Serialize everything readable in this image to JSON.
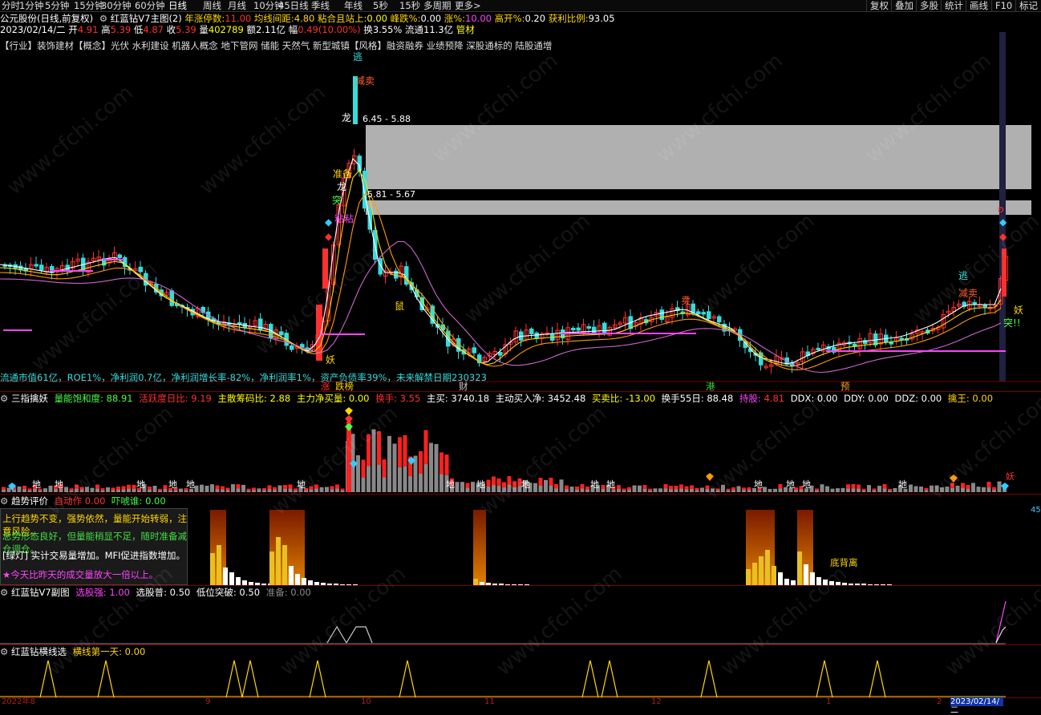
{
  "toolbar": {
    "left_items": [
      "分时",
      "1分钟",
      "5分钟",
      "15分钟",
      "30分钟",
      "60分钟",
      "日线",
      "周线",
      "月线",
      "10分钟",
      "45日线",
      "季线",
      "年线",
      "5秒",
      "15秒",
      "多周期",
      "更多>"
    ],
    "active_index": 6,
    "right_items": [
      "复权",
      "叠加",
      "多股",
      "统计",
      "画线",
      "F10",
      "标记"
    ]
  },
  "header": {
    "title": "公元股份(日线,前复权)",
    "indicator": "红蓝钻V7主图(2)",
    "fields": [
      {
        "label": "年涨停数:",
        "value": "11.00",
        "color": "#ff3030"
      },
      {
        "label": "均线间距:",
        "value": "4.80",
        "color": "#ffd700"
      },
      {
        "label": "粘合且站上:",
        "value": "0.00",
        "color": "#ffff00"
      },
      {
        "label": "峰跌%:",
        "value": "0.00",
        "color": "#ffffff"
      },
      {
        "label": "涨%:",
        "value": "10.00",
        "color": "#ff44ff"
      },
      {
        "label": "高开%:",
        "value": "0.20",
        "color": "#ffffff"
      },
      {
        "label": "获利比例:",
        "value": "93.05",
        "color": "#ffffff"
      }
    ]
  },
  "quote": {
    "date": "2023/02/14/二",
    "open_label": "开",
    "open": "4.91",
    "high_label": "高",
    "high": "5.39",
    "low_label": "低",
    "low": "4.87",
    "close_label": "收",
    "close": "5.39",
    "vol_label": "量",
    "vol": "402789",
    "amount_label": "额",
    "amount": "2.11亿",
    "change_label": "幅",
    "change": "0.49(10.00%)",
    "turnover_label": "换",
    "turnover": "3.55%",
    "float_label": "流通",
    "float": "11.3亿",
    "sector": "管材"
  },
  "concepts": "【行业】装饰建材【概念】光伏 水利建设 机器人概念 地下管网 储能 天然气 新型城镇【风格】融资融券 业绩预降 深股通标的 陆股通增",
  "main_chart": {
    "annotations": {
      "escape_top": "逃",
      "reduce_sell_top": "减卖",
      "dragon1": "龙",
      "range_high": "6.45 - 5.88",
      "prepare": "准备",
      "dragon2": "龙",
      "range_low": "5.81 - 5.67",
      "buy": "突",
      "sticky": "粘粘",
      "demon": "妖",
      "rat": "鼠",
      "sell": "卖",
      "escape_right": "逃",
      "reduce_sell_right": "减卖",
      "demon_right": "妖",
      "break_right": "突!!"
    },
    "fundamentals": "流通市值61亿，ROE1%，净利润0.7亿，净利润增长率-82%，净利润率1%，资产负债率39%，未来解禁日期230323",
    "bottom_tags": [
      {
        "text": "涨",
        "color": "#ff3030"
      },
      {
        "text": "跌榜",
        "color": "#ffd700"
      },
      {
        "text": "财",
        "color": "#cccccc"
      },
      {
        "text": "港",
        "color": "#33dd33"
      },
      {
        "text": "预",
        "color": "#ffa500"
      }
    ]
  },
  "panel2": {
    "name": "三指擒妖",
    "fields": [
      {
        "label": "量能饱和度:",
        "value": "88.91",
        "label_color": "#44ff44",
        "value_color": "#44ff44"
      },
      {
        "label": "活跃度日比:",
        "value": "9.19",
        "label_color": "#ff3030",
        "value_color": "#ff3030"
      },
      {
        "label": "主散筹码比:",
        "value": "2.88",
        "label_color": "#ffff00",
        "value_color": "#ffff00"
      },
      {
        "label": "主力净买量:",
        "value": "0.00",
        "label_color": "#ffff00",
        "value_color": "#ffff00"
      },
      {
        "label": "换手:",
        "value": "3.55",
        "label_color": "#ff3030",
        "value_color": "#ff3030"
      },
      {
        "label": "主买:",
        "value": "3740.18",
        "label_color": "#ffffff",
        "value_color": "#ffffff"
      },
      {
        "label": "主动买入净:",
        "value": "3452.48",
        "label_color": "#ffffff",
        "value_color": "#ffffff"
      },
      {
        "label": "买卖比:",
        "value": "-13.00",
        "label_color": "#ffff00",
        "value_color": "#ffff00"
      },
      {
        "label": "换手55日:",
        "value": "88.48",
        "label_color": "#ffffff",
        "value_color": "#ffffff"
      },
      {
        "label": "持股:",
        "value": "4.81",
        "label_color": "#ff44ff",
        "value_color": "#ff3030"
      },
      {
        "label": "DDX:",
        "value": "0.00",
        "label_color": "#ffffff",
        "value_color": "#ffffff"
      },
      {
        "label": "DDY:",
        "value": "0.00",
        "label_color": "#ffffff",
        "value_color": "#ffffff"
      },
      {
        "label": "DDZ:",
        "value": "0.00",
        "label_color": "#ffffff",
        "value_color": "#ffffff"
      },
      {
        "label": "擒王:",
        "value": "0.00",
        "label_color": "#ffd700",
        "value_color": "#ffd700"
      }
    ],
    "ground_label": "地",
    "demon_label": "妖"
  },
  "panel3": {
    "name": "趋势评价",
    "fields": [
      {
        "label": "自动作",
        "value": "0.00",
        "color": "#ff3030"
      },
      {
        "label": "吓唬谁:",
        "value": "0.00",
        "color": "#44ff44"
      }
    ],
    "notes": [
      {
        "text": "上行趋势不变，强势依然，量能开始转弱，注意风险。",
        "color": "#ffd700"
      },
      {
        "text": "总势形态良好，但量能稍显不足，随时准备减仓调仓。",
        "color": "#44dd44"
      },
      {
        "text": "[绿灯] 实计交易量增加。MFI促进指数增加。",
        "color": "#ffffff"
      },
      {
        "text": "★今天比昨天的成交量放大一倍以上。",
        "color": "#ff44ff"
      }
    ],
    "bottom_divergence": "底背离",
    "scale_value": "45"
  },
  "panel4": {
    "name": "红蓝钻V7副图",
    "fields": [
      {
        "label": "选股强:",
        "value": "1.00",
        "color": "#ff44ff"
      },
      {
        "label": "选股普:",
        "value": "0.50",
        "color": "#ffffff"
      },
      {
        "label": "低位突破:",
        "value": "0.50",
        "color": "#ffffff"
      },
      {
        "label": "准备:",
        "value": "0.00",
        "color": "#888888"
      }
    ]
  },
  "panel5": {
    "name": "红蓝钻横线选",
    "fields": [
      {
        "label": "横线第一天:",
        "value": "0.00",
        "color": "#ffd700"
      }
    ]
  },
  "date_axis": {
    "labels": [
      "2022年8",
      "9",
      "10",
      "11",
      "12",
      "1",
      "2"
    ],
    "selected": "2023/02/14/二"
  },
  "watermark": "www.cfchi.com",
  "colors": {
    "up": "#ff3030",
    "down": "#33dddd",
    "ma5": "#ffffff",
    "ma10": "#ffd700",
    "ma20": "#ff9900",
    "ma60": "#cc66cc",
    "grid": "#7a0000",
    "zone": "#b0b0b0"
  }
}
